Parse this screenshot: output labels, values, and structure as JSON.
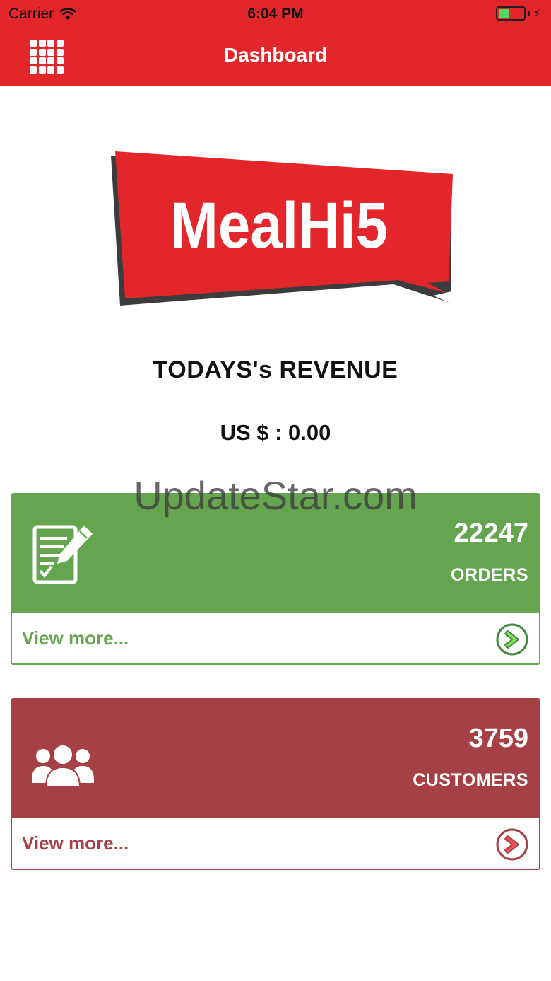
{
  "status_bar": {
    "carrier": "Carrier",
    "time": "6:04 PM",
    "battery_level": 0.45
  },
  "header": {
    "title": "Dashboard",
    "menu_icon": "grid-menu-icon",
    "color": "#e3262b"
  },
  "logo": {
    "text": "MealHi5"
  },
  "revenue": {
    "title": "TODAYS's REVENUE",
    "value": "US $ : 0.00"
  },
  "watermark": "UpdateStar.com",
  "orders_card": {
    "count": "22247",
    "label": "ORDERS",
    "view_more": "View more...",
    "icon": "checklist-edit-icon",
    "color": "#65a54f"
  },
  "customers_card": {
    "count": "3759",
    "label": "CUSTOMERS",
    "view_more": "View more...",
    "icon": "users-group-icon",
    "color": "#a54144"
  }
}
